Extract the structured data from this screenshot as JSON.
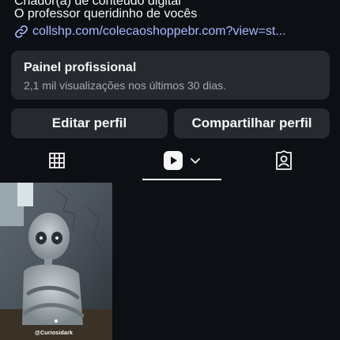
{
  "bio": {
    "category_cut": "Criador(a) de conteúdo digital",
    "line": "O professor queridinho de vocês",
    "link": "collshp.com/colecaoshoppebr.com?view=st..."
  },
  "professional_panel": {
    "title": "Painel profissional",
    "subtitle": "2,1 mil visualizações nos últimos 30 dias."
  },
  "buttons": {
    "edit": "Editar perfil",
    "share": "Compartilhar perfil"
  },
  "tabs": [
    {
      "icon": "grid-icon",
      "selected": false
    },
    {
      "icon": "reels-play-icon",
      "selected": true,
      "has_dropdown": true
    },
    {
      "icon": "tagged-person-icon",
      "selected": false
    }
  ],
  "reel_thumbnail": {
    "watermark": "@Curiosidark"
  },
  "colors": {
    "background": "#0c1014",
    "panel": "#262a30",
    "link": "#a9b8ff",
    "text": "#f5f5f5",
    "muted": "#a8a8a8"
  }
}
